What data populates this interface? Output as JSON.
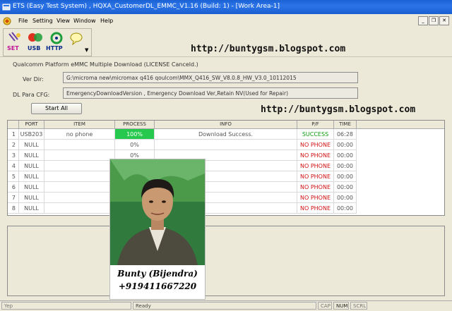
{
  "window": {
    "title": "ETS (Easy Test System) , HQXA_CustomerDL_EMMC_V1.16 (Build: 1) - [Work Area-1]"
  },
  "menu": [
    "File",
    "Setting",
    "View",
    "Window",
    "Help"
  ],
  "toolbar": {
    "buttons": [
      {
        "label": "SET",
        "icon": "set-icon"
      },
      {
        "label": "USB",
        "icon": "usb-icon"
      },
      {
        "label": "HTTP",
        "icon": "http-icon"
      },
      {
        "label": "",
        "icon": "chat-icon"
      }
    ]
  },
  "watermark": {
    "url": "http://buntygsm.blogspot.com"
  },
  "form": {
    "title": "Qualcomm Platform eMMC Multiple Download (LICENSE Canceld.)",
    "ver_dir_label": "Ver Dir:",
    "ver_dir_value": "G:\\microma new\\micromax q416 qoulcom\\MMX_Q416_SW_V8.0.8_HW_V3.0_10112015",
    "dl_para_label": "DL Para CFG:",
    "dl_para_value": "EmergencyDownloadVersion , Emergency Download Ver,Retain NV(Used for Repair)",
    "start_button": "Start All"
  },
  "table": {
    "columns": [
      "PORT",
      "ITEM",
      "PROCESS",
      "INFO",
      "P/F",
      "TIME"
    ],
    "rows": [
      {
        "idx": "1",
        "port": "USB203",
        "item": "no phone",
        "process": "100%",
        "info": "Download Success.",
        "pf": "SUCCESS",
        "time": "06:28"
      },
      {
        "idx": "2",
        "port": "NULL",
        "item": "",
        "process": "0%",
        "info": "",
        "pf": "NO PHONE",
        "time": "00:00"
      },
      {
        "idx": "3",
        "port": "NULL",
        "item": "",
        "process": "0%",
        "info": "",
        "pf": "NO PHONE",
        "time": "00:00"
      },
      {
        "idx": "4",
        "port": "NULL",
        "item": "",
        "process": "",
        "info": "",
        "pf": "NO PHONE",
        "time": "00:00"
      },
      {
        "idx": "5",
        "port": "NULL",
        "item": "",
        "process": "",
        "info": "",
        "pf": "NO PHONE",
        "time": "00:00"
      },
      {
        "idx": "6",
        "port": "NULL",
        "item": "",
        "process": "",
        "info": "",
        "pf": "NO PHONE",
        "time": "00:00"
      },
      {
        "idx": "7",
        "port": "NULL",
        "item": "",
        "process": "",
        "info": "",
        "pf": "NO PHONE",
        "time": "00:00"
      },
      {
        "idx": "8",
        "port": "NULL",
        "item": "",
        "process": "",
        "info": "",
        "pf": "NO PHONE",
        "time": "00:00"
      }
    ]
  },
  "photo": {
    "name": "Bunty (Bijendra)",
    "phone": "+919411667220"
  },
  "statusbar": {
    "left": "Yep",
    "middle": "Ready",
    "caps": "CAP",
    "num": "NUM",
    "scrl": "SCRL"
  },
  "colors": {
    "title_bar": "#2b74e8",
    "success": "#0a9a0a",
    "fail": "#d01010",
    "progress": "#26c94d"
  }
}
